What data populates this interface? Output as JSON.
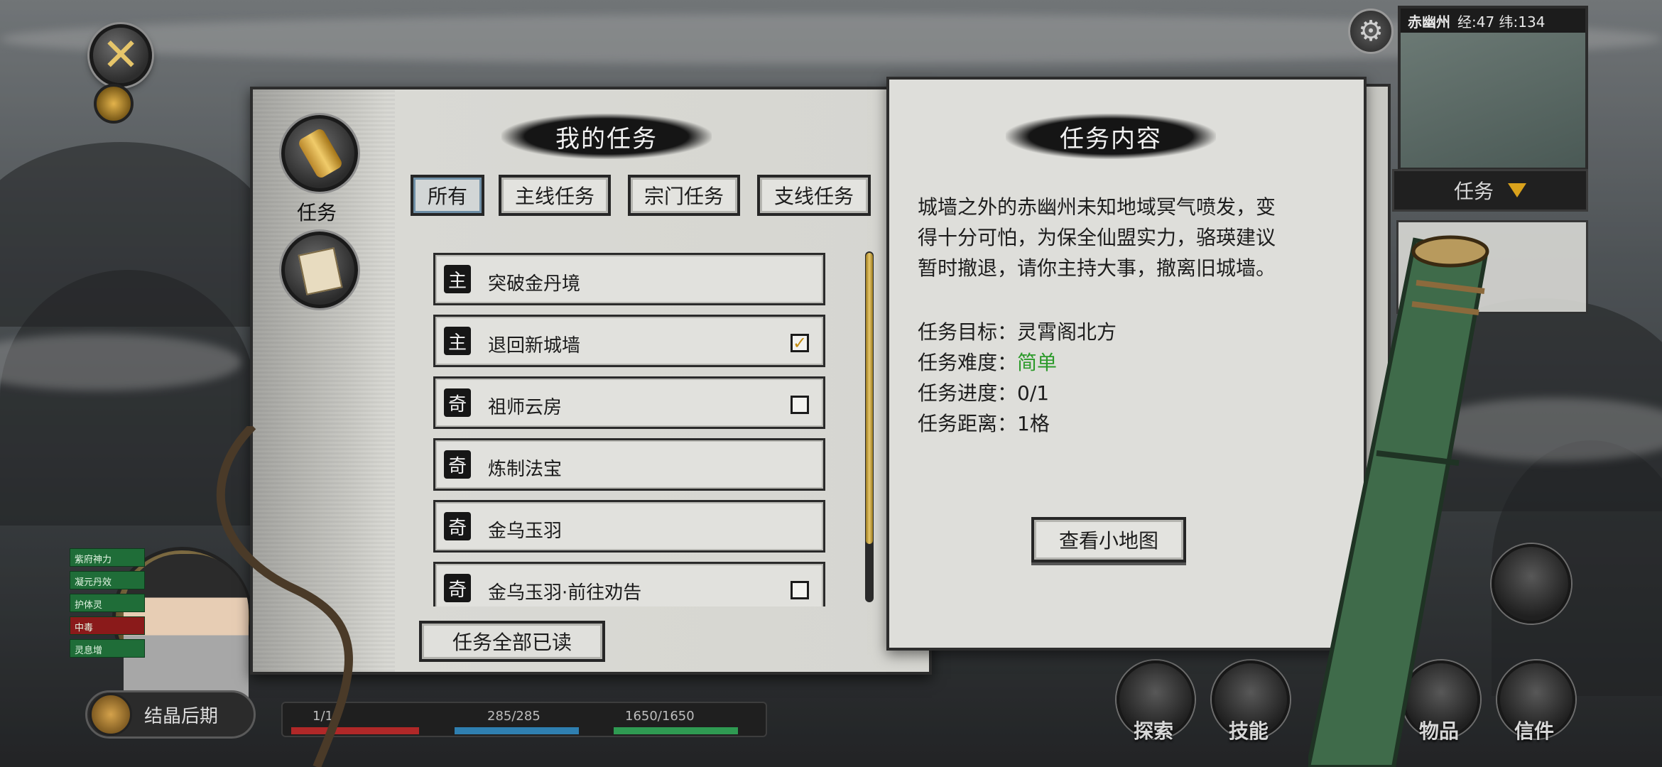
{
  "top_left": {
    "close_icon": "close-x-icon",
    "compass_icon": "compass-icon"
  },
  "minimap": {
    "location": "赤幽州",
    "clock": "经:47 纬:134",
    "gear_icon": "gear-icon",
    "quest_dropdown_label": "任务"
  },
  "side_tabs": [
    {
      "label": "任务",
      "icon": "scroll-icon"
    },
    {
      "label": "",
      "icon": "letters-icon"
    }
  ],
  "quest_panel": {
    "heading": "我的任务",
    "filters": [
      "所有",
      "主线任务",
      "宗门任务",
      "支线任务"
    ],
    "active_filter": "所有",
    "quests": [
      {
        "badge": "主",
        "name": "突破金丹境",
        "check": "none"
      },
      {
        "badge": "主",
        "name": "退回新城墙",
        "check": "checked"
      },
      {
        "badge": "奇",
        "name": "祖师云房",
        "check": "empty"
      },
      {
        "badge": "奇",
        "name": "炼制法宝",
        "check": "none"
      },
      {
        "badge": "奇",
        "name": "金乌玉羽",
        "check": "none"
      },
      {
        "badge": "奇",
        "name": "金乌玉羽·前往劝告",
        "check": "empty"
      }
    ],
    "mark_all_read": "任务全部已读"
  },
  "detail_panel": {
    "heading": "任务内容",
    "description_lines": [
      "城墙之外的赤幽州未知地域冥气喷发，变",
      "得十分可怕，为保全仙盟实力，骆瑛建议",
      "暂时撤退，请你主持大事，撤离旧城墙。"
    ],
    "target_label": "任务目标：",
    "target_value": "灵霄阁北方",
    "difficulty_label": "任务难度：",
    "difficulty_value": "简单",
    "progress_label": "任务进度：",
    "progress_value": "0/1",
    "distance_label": "任务距离：",
    "distance_value": "1格",
    "view_map_button": "查看小地图"
  },
  "hud": {
    "realm": "结晶后期",
    "status_tags": [
      "紫府神力",
      "凝元丹效",
      "护体灵",
      "中毒",
      "灵息增"
    ],
    "hp": "1/1",
    "mp": "285/285",
    "stamina": "1650/1650",
    "buttons": [
      "探索",
      "技能",
      "物品",
      "信件"
    ]
  },
  "colors": {
    "easy_green": "#2c9a2a",
    "gold": "#d9a21c",
    "ink": "#151515"
  }
}
